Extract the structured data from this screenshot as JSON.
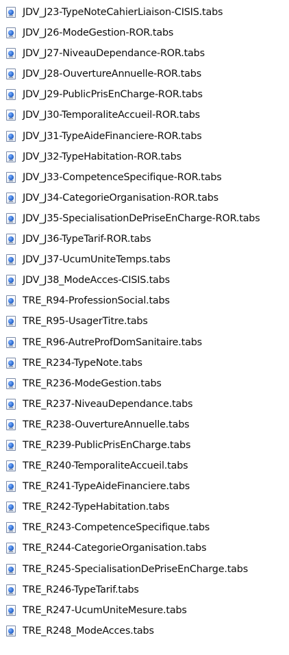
{
  "files": [
    {
      "name": "JDV_J23-TypeNoteCahierLiaison-CISIS.tabs",
      "icon": "tabs-file-icon"
    },
    {
      "name": "JDV_J26-ModeGestion-ROR.tabs",
      "icon": "tabs-file-icon"
    },
    {
      "name": "JDV_J27-NiveauDependance-ROR.tabs",
      "icon": "tabs-file-icon"
    },
    {
      "name": "JDV_J28-OuvertureAnnuelle-ROR.tabs",
      "icon": "tabs-file-icon"
    },
    {
      "name": "JDV_J29-PublicPrisEnCharge-ROR.tabs",
      "icon": "tabs-file-icon"
    },
    {
      "name": "JDV_J30-TemporaliteAccueil-ROR.tabs",
      "icon": "tabs-file-icon"
    },
    {
      "name": "JDV_J31-TypeAideFinanciere-ROR.tabs",
      "icon": "tabs-file-icon"
    },
    {
      "name": "JDV_J32-TypeHabitation-ROR.tabs",
      "icon": "tabs-file-icon"
    },
    {
      "name": "JDV_J33-CompetenceSpecifique-ROR.tabs",
      "icon": "tabs-file-icon"
    },
    {
      "name": "JDV_J34-CategorieOrganisation-ROR.tabs",
      "icon": "tabs-file-icon"
    },
    {
      "name": "JDV_J35-SpecialisationDePriseEnCharge-ROR.tabs",
      "icon": "tabs-file-icon"
    },
    {
      "name": "JDV_J36-TypeTarif-ROR.tabs",
      "icon": "tabs-file-icon"
    },
    {
      "name": "JDV_J37-UcumUniteTemps.tabs",
      "icon": "tabs-file-icon"
    },
    {
      "name": "JDV_J38_ModeAcces-CISIS.tabs",
      "icon": "tabs-file-icon"
    },
    {
      "name": "TRE_R94-ProfessionSocial.tabs",
      "icon": "tabs-file-icon"
    },
    {
      "name": "TRE_R95-UsagerTitre.tabs",
      "icon": "tabs-file-icon"
    },
    {
      "name": "TRE_R96-AutreProfDomSanitaire.tabs",
      "icon": "tabs-file-icon"
    },
    {
      "name": "TRE_R234-TypeNote.tabs",
      "icon": "tabs-file-icon"
    },
    {
      "name": "TRE_R236-ModeGestion.tabs",
      "icon": "tabs-file-icon"
    },
    {
      "name": "TRE_R237-NiveauDependance.tabs",
      "icon": "tabs-file-icon"
    },
    {
      "name": "TRE_R238-OuvertureAnnuelle.tabs",
      "icon": "tabs-file-icon"
    },
    {
      "name": "TRE_R239-PublicPrisEnCharge.tabs",
      "icon": "tabs-file-icon"
    },
    {
      "name": "TRE_R240-TemporaliteAccueil.tabs",
      "icon": "tabs-file-icon"
    },
    {
      "name": "TRE_R241-TypeAideFinanciere.tabs",
      "icon": "tabs-file-icon"
    },
    {
      "name": "TRE_R242-TypeHabitation.tabs",
      "icon": "tabs-file-icon"
    },
    {
      "name": "TRE_R243-CompetenceSpecifique.tabs",
      "icon": "tabs-file-icon"
    },
    {
      "name": "TRE_R244-CategorieOrganisation.tabs",
      "icon": "tabs-file-icon"
    },
    {
      "name": "TRE_R245-SpecialisationDePriseEnCharge.tabs",
      "icon": "tabs-file-icon"
    },
    {
      "name": "TRE_R246-TypeTarif.tabs",
      "icon": "tabs-file-icon"
    },
    {
      "name": "TRE_R247-UcumUniteMesure.tabs",
      "icon": "tabs-file-icon"
    },
    {
      "name": "TRE_R248_ModeAcces.tabs",
      "icon": "tabs-file-icon"
    }
  ]
}
